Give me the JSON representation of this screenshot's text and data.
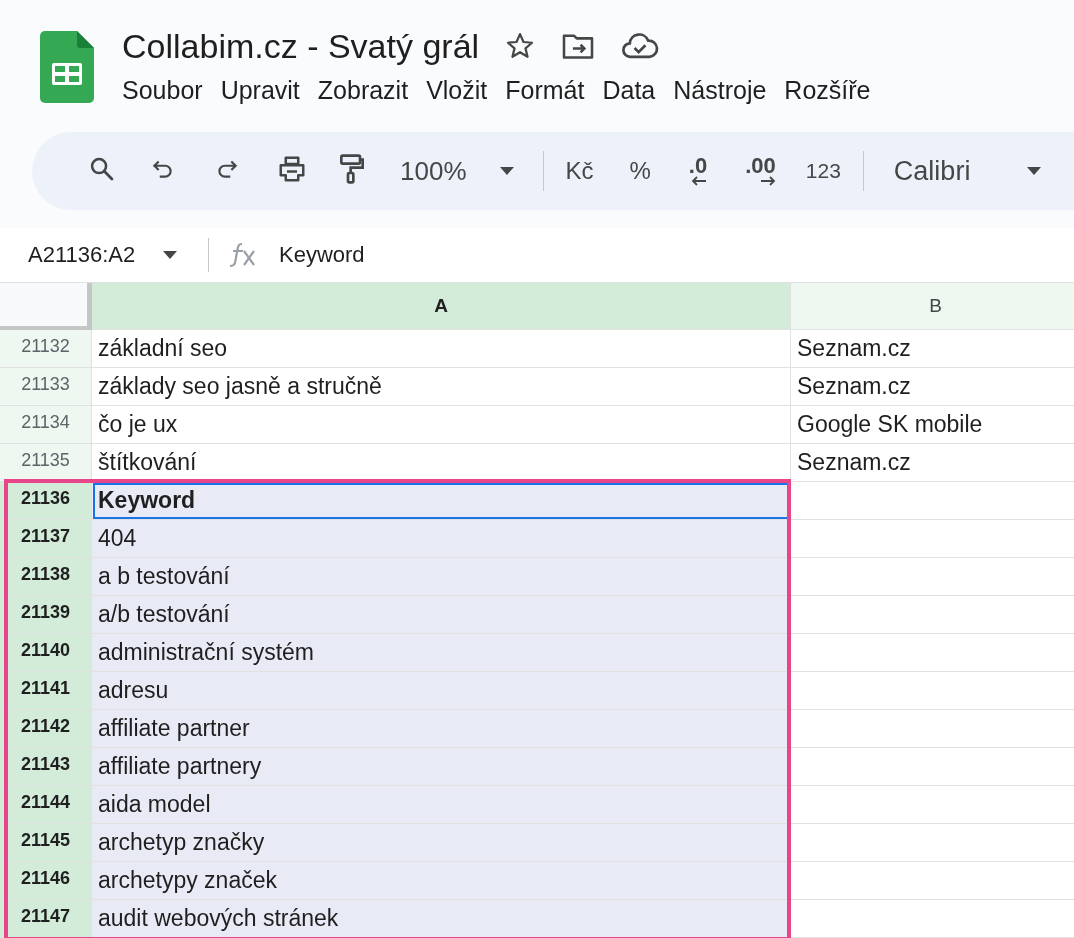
{
  "document": {
    "title": "Collabim.cz - Svatý grál"
  },
  "menu": [
    "Soubor",
    "Upravit",
    "Zobrazit",
    "Vložit",
    "Formát",
    "Data",
    "Nástroje",
    "Rozšíře"
  ],
  "toolbar": {
    "zoom": "100%",
    "currency": "Kč",
    "percent": "%",
    "decrease_decimals": ".0",
    "increase_decimals": ".00",
    "number_format": "123",
    "font": "Calibri"
  },
  "formula_bar": {
    "name_box": "A21136:A2",
    "value": "Keyword"
  },
  "columns": [
    {
      "label": "A",
      "selected": true
    },
    {
      "label": "B",
      "selected": false
    }
  ],
  "rows": [
    {
      "number": "21132",
      "a": "základní seo",
      "b": "Seznam.cz",
      "selected": false,
      "active": false
    },
    {
      "number": "21133",
      "a": "základy seo jasně a stručně",
      "b": "Seznam.cz",
      "selected": false,
      "active": false
    },
    {
      "number": "21134",
      "a": "čo je ux",
      "b": "Google SK mobile",
      "selected": false,
      "active": false
    },
    {
      "number": "21135",
      "a": "štítkování",
      "b": "Seznam.cz",
      "selected": false,
      "active": false
    },
    {
      "number": "21136",
      "a": "Keyword",
      "selected": true,
      "active": true
    },
    {
      "number": "21137",
      "a": "404",
      "selected": true,
      "active": false
    },
    {
      "number": "21138",
      "a": "a b testování",
      "selected": true,
      "active": false
    },
    {
      "number": "21139",
      "a": "a/b testování",
      "selected": true,
      "active": false
    },
    {
      "number": "21140",
      "a": "administrační systém",
      "selected": true,
      "active": false
    },
    {
      "number": "21141",
      "a": "adresu",
      "selected": true,
      "active": false
    },
    {
      "number": "21142",
      "a": "affiliate partner",
      "selected": true,
      "active": false
    },
    {
      "number": "21143",
      "a": "affiliate partnery",
      "selected": true,
      "active": false
    },
    {
      "number": "21144",
      "a": "aida model",
      "selected": true,
      "active": false
    },
    {
      "number": "21145",
      "a": "archetyp značky",
      "selected": true,
      "active": false
    },
    {
      "number": "21146",
      "a": "archetypy značek",
      "selected": true,
      "active": false
    },
    {
      "number": "21147",
      "a": "audit webových stránek",
      "selected": true,
      "active": false
    }
  ]
}
